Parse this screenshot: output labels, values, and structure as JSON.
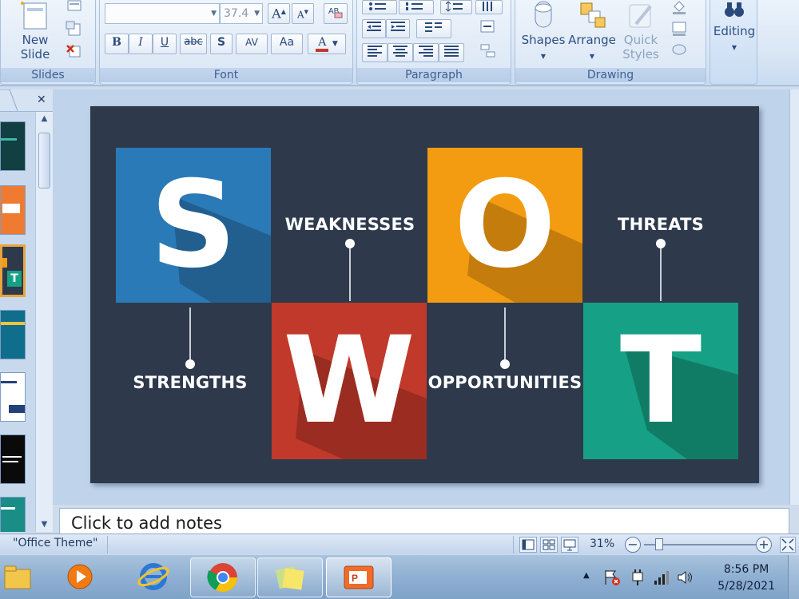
{
  "ribbon": {
    "slides_group": {
      "label": "Slides",
      "new_slide": "New\nSlide"
    },
    "font_group": {
      "label": "Font",
      "font_name": "",
      "font_size": "37.4",
      "grow": "A",
      "shrink": "A",
      "bold": "B",
      "italic": "I",
      "underline": "U",
      "strike": "abc",
      "shadow": "S",
      "spacing": "AV",
      "case": "Aa",
      "color": "A"
    },
    "paragraph_group": {
      "label": "Paragraph"
    },
    "drawing_group": {
      "label": "Drawing",
      "shapes": "Shapes",
      "arrange": "Arrange",
      "quick_styles": "Quick\nStyles"
    },
    "editing_group": {
      "label": "Editing"
    }
  },
  "slide": {
    "tiles": [
      {
        "letter": "S",
        "color": "#2a7ab8",
        "shade": "#225f8f"
      },
      {
        "letter": "W",
        "color": "#c0392b",
        "shade": "#9a2c21"
      },
      {
        "letter": "O",
        "color": "#f39c12",
        "shade": "#c47c0d"
      },
      {
        "letter": "T",
        "color": "#16a085",
        "shade": "#117c66"
      }
    ],
    "labels": {
      "strengths": "STRENGTHS",
      "weaknesses": "WEAKNESSES",
      "opportunities": "OPPORTUNITIES",
      "threats": "THREATS"
    },
    "background": "#2e3a4c"
  },
  "notes": {
    "placeholder": "Click to add notes"
  },
  "status": {
    "theme": "\"Office Theme\"",
    "zoom": "31%"
  },
  "taskbar": {
    "apps": [
      "windows-explorer",
      "media-player",
      "internet-explorer",
      "chrome",
      "sticky-notes",
      "powerpoint"
    ],
    "time": "8:56 PM",
    "date": "5/28/2021"
  },
  "colors": {
    "ribbon": "#dbe7f5",
    "accent": "#15428b"
  }
}
